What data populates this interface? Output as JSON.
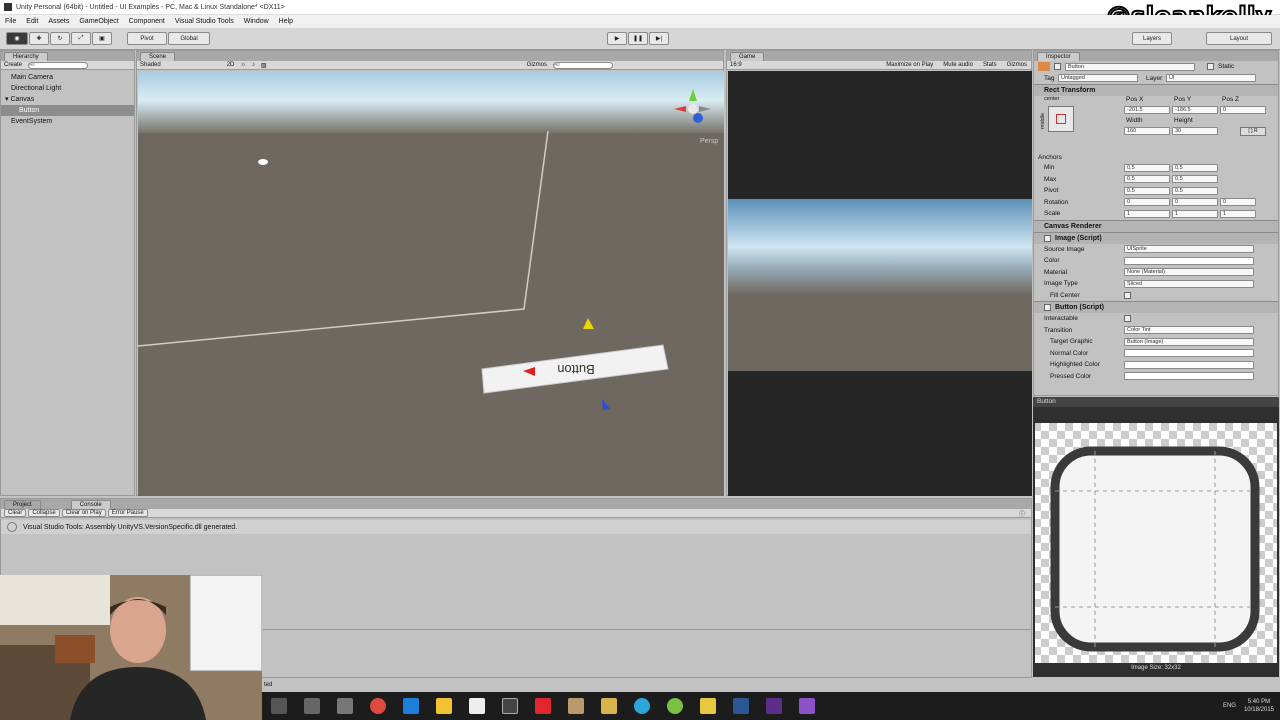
{
  "window": {
    "title": "Unity Personal (64bit) - Untitled - UI Examples - PC, Mac & Linux Standalone* <DX11>"
  },
  "watermark": "@sloankelly",
  "menu": [
    "File",
    "Edit",
    "Assets",
    "GameObject",
    "Component",
    "Visual Studio Tools",
    "Window",
    "Help"
  ],
  "toolbar": {
    "pivot": "Pivot",
    "global": "Global",
    "layers": "Layers",
    "layout": "Layout"
  },
  "hierarchy": {
    "tab": "Hierarchy",
    "create": "Create",
    "search_placeholder": "All",
    "items": [
      {
        "label": "Main Camera"
      },
      {
        "label": "Directional Light"
      },
      {
        "label": "Canvas"
      },
      {
        "label": "Button"
      },
      {
        "label": "EventSystem"
      }
    ]
  },
  "scene": {
    "tab": "Scene",
    "shading": "Shaded",
    "mode2d": "2D",
    "gizmos": "Gizmos",
    "search_placeholder": "All",
    "persp": "Persp",
    "button_text": "Button"
  },
  "game": {
    "tab": "Game",
    "aspect": "16:9",
    "maximize": "Maximize on Play",
    "mute": "Mute audio",
    "stats": "Stats",
    "gizmos": "Gizmos"
  },
  "inspector": {
    "tab": "Inspector",
    "object_name": "Button",
    "static": "Static",
    "tag_label": "Tag",
    "tag_value": "Untagged",
    "layer_label": "Layer",
    "layer_value": "UI",
    "rect_transform": "Rect Transform",
    "anchor_preset": "center",
    "anchor_preset_side": "middle",
    "pos_x_label": "Pos X",
    "pos_y_label": "Pos Y",
    "pos_z_label": "Pos Z",
    "pos_x": "-201.5",
    "pos_y": "-186.5",
    "pos_z": "0",
    "width_label": "Width",
    "height_label": "Height",
    "width": "160",
    "height": "30",
    "anchors": "Anchors",
    "min": "Min",
    "max": "Max",
    "pivot": "Pivot",
    "min_x": "0.5",
    "min_y": "0.5",
    "max_x": "0.5",
    "max_y": "0.5",
    "pivot_x": "0.5",
    "pivot_y": "0.5",
    "rotation": "Rotation",
    "scale": "Scale",
    "rot_x": "0",
    "rot_y": "0",
    "rot_z": "0",
    "scale_x": "1",
    "scale_y": "1",
    "scale_z": "1",
    "canvas_renderer": "Canvas Renderer",
    "image_script": "Image (Script)",
    "source_image": "Source Image",
    "source_image_value": "UISprite",
    "color": "Color",
    "material": "Material",
    "material_value": "None (Material)",
    "image_type": "Image Type",
    "image_type_value": "Sliced",
    "fill_center": "Fill Center",
    "button_script": "Button (Script)",
    "interactable": "Interactable",
    "transition": "Transition",
    "transition_value": "Color Tint",
    "target_graphic": "Target Graphic",
    "target_graphic_value": "Button (Image)",
    "normal_color": "Normal Color",
    "highlighted_color": "Highlighted Color",
    "pressed_color": "Pressed Color"
  },
  "preview": {
    "title": "Button",
    "image_size": "Image Size: 32x32"
  },
  "console": {
    "tab_project": "Project",
    "tab_console": "Console",
    "clear": "Clear",
    "collapse": "Collapse",
    "clear_on_play": "Clear on Play",
    "error_pause": "Error Pause",
    "message": "Visual Studio Tools: Assembly UnityVS.VersionSpecific.dll generated."
  },
  "status": "ted",
  "clock": {
    "time": "5:40 PM",
    "date": "10/18/2015",
    "lang": "ENG"
  },
  "colors": {
    "scene_ground": "#6e6860",
    "sky": "#b9d9ec",
    "game_bg": "#262626"
  },
  "taskbar_icons": [
    "windows-icon",
    "task-view-icon",
    "search-icon",
    "chrome-icon",
    "edge-icon",
    "file-explorer-icon",
    "store-icon",
    "unity-icon",
    "vivaldi-icon",
    "notepad-icon",
    "globe-icon",
    "app-icon",
    "premiere-icon",
    "visual-studio-icon",
    "word-icon",
    "powerpoint-icon",
    "firefox-icon"
  ]
}
